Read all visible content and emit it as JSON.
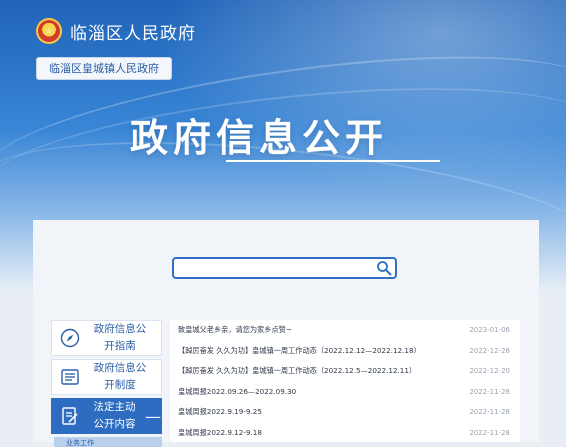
{
  "header": {
    "site_title": "临淄区人民政府",
    "sub_site": "临淄区皇城镇人民政府",
    "page_title": "政府信息公开"
  },
  "search": {
    "placeholder": ""
  },
  "sidebar": {
    "items": [
      {
        "label": "政府信息公开指南",
        "icon": "compass-icon"
      },
      {
        "label": "政府信息公开制度",
        "icon": "list-document-icon"
      },
      {
        "label": "法定主动公开内容",
        "icon": "document-edit-icon",
        "active": true,
        "toggle": "—"
      }
    ],
    "subnav_label": "业务工作"
  },
  "news": {
    "rows": [
      {
        "title": "致皇城父老乡亲，请您为家乡点赞~",
        "date": "2023-01-06"
      },
      {
        "title": "【踔厉奋发 久久为功】皇城镇一周工作动态（2022.12.12—2022.12.18）",
        "date": "2022-12-28"
      },
      {
        "title": "【踔厉奋发 久久为功】皇城镇一周工作动态（2022.12.5—2022.12.11）",
        "date": "2022-12-20"
      },
      {
        "title": "皇城周报2022.09.26—2022.09.30",
        "date": "2022-11-28"
      },
      {
        "title": "皇城周报2022.9.19-9.25",
        "date": "2022-11-28"
      },
      {
        "title": "皇城周报2022.9.12-9.18",
        "date": "2022-11-28"
      }
    ]
  },
  "colors": {
    "primary": "#2d6cc0",
    "text_blue": "#2a5ea8"
  }
}
